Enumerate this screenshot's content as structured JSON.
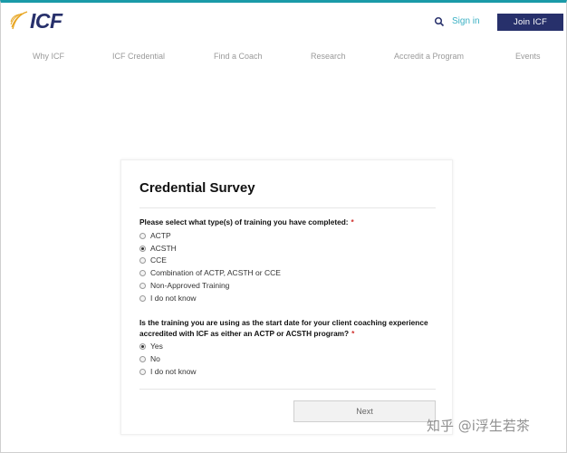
{
  "header": {
    "logo_text": "ICF",
    "signin_label": "Sign in",
    "join_label": "Join ICF"
  },
  "nav": [
    {
      "label": "Why ICF"
    },
    {
      "label": "ICF Credential"
    },
    {
      "label": "Find a Coach"
    },
    {
      "label": "Research"
    },
    {
      "label": "Accredit a Program"
    },
    {
      "label": "Events"
    }
  ],
  "survey": {
    "title": "Credential Survey",
    "q1": {
      "label": "Please select what type(s) of training you have completed:",
      "required_mark": "*",
      "options": [
        {
          "label": "ACTP",
          "checked": false
        },
        {
          "label": "ACSTH",
          "checked": true
        },
        {
          "label": "CCE",
          "checked": false
        },
        {
          "label": "Combination of ACTP, ACSTH or CCE",
          "checked": false
        },
        {
          "label": "Non-Approved Training",
          "checked": false
        },
        {
          "label": "I do not know",
          "checked": false
        }
      ]
    },
    "q2": {
      "label_line1": "Is the training you are using as the start date for your client coaching experience",
      "label_line2": "accredited with ICF as either an ACTP or ACSTH program?",
      "required_mark": "*",
      "options": [
        {
          "label": "Yes",
          "checked": true
        },
        {
          "label": "No",
          "checked": false
        },
        {
          "label": "I do not know",
          "checked": false
        }
      ]
    },
    "next_label": "Next"
  },
  "watermark": "知乎 @i浮生若茶",
  "colors": {
    "brand_navy": "#27306b",
    "accent_teal": "#3ab0c4",
    "logo_gold": "#e8a623",
    "required_red": "#d0312d"
  }
}
